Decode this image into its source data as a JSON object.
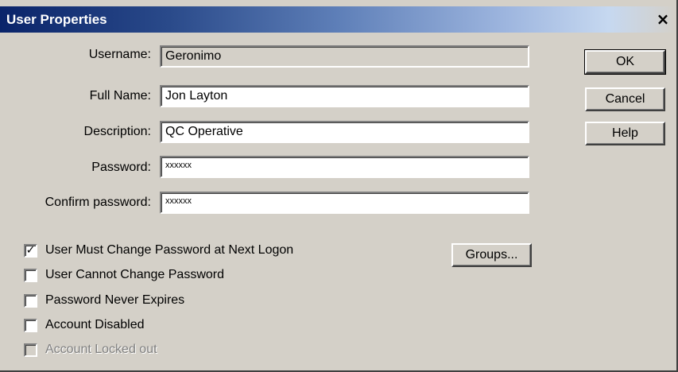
{
  "window": {
    "title": "User Properties",
    "close_glyph": "×"
  },
  "fields": [
    {
      "label": "Username:",
      "value": "Geronimo",
      "readonly": true
    },
    {
      "label": "Full Name:",
      "value": "Jon Layton",
      "readonly": false
    },
    {
      "label": "Description:",
      "value": "QC Operative",
      "readonly": false
    },
    {
      "label": "Password:",
      "value": "xxxxxx",
      "readonly": false
    },
    {
      "label": "Confirm password:",
      "value": "xxxxxx",
      "readonly": false
    }
  ],
  "buttons": {
    "ok": "OK",
    "cancel": "Cancel",
    "help": "Help",
    "groups": "Groups..."
  },
  "checkboxes": [
    {
      "label": "User Must Change Password at Next Logon",
      "checked": true,
      "disabled": false
    },
    {
      "label": "User Cannot Change Password",
      "checked": false,
      "disabled": false
    },
    {
      "label": "Password Never Expires",
      "checked": false,
      "disabled": false
    },
    {
      "label": "Account Disabled",
      "checked": false,
      "disabled": false
    },
    {
      "label": "Account Locked out",
      "checked": false,
      "disabled": true
    }
  ],
  "colors": {
    "face": "#d4d0c8",
    "title_active": "#0a246a",
    "disabled_text": "#808080"
  }
}
